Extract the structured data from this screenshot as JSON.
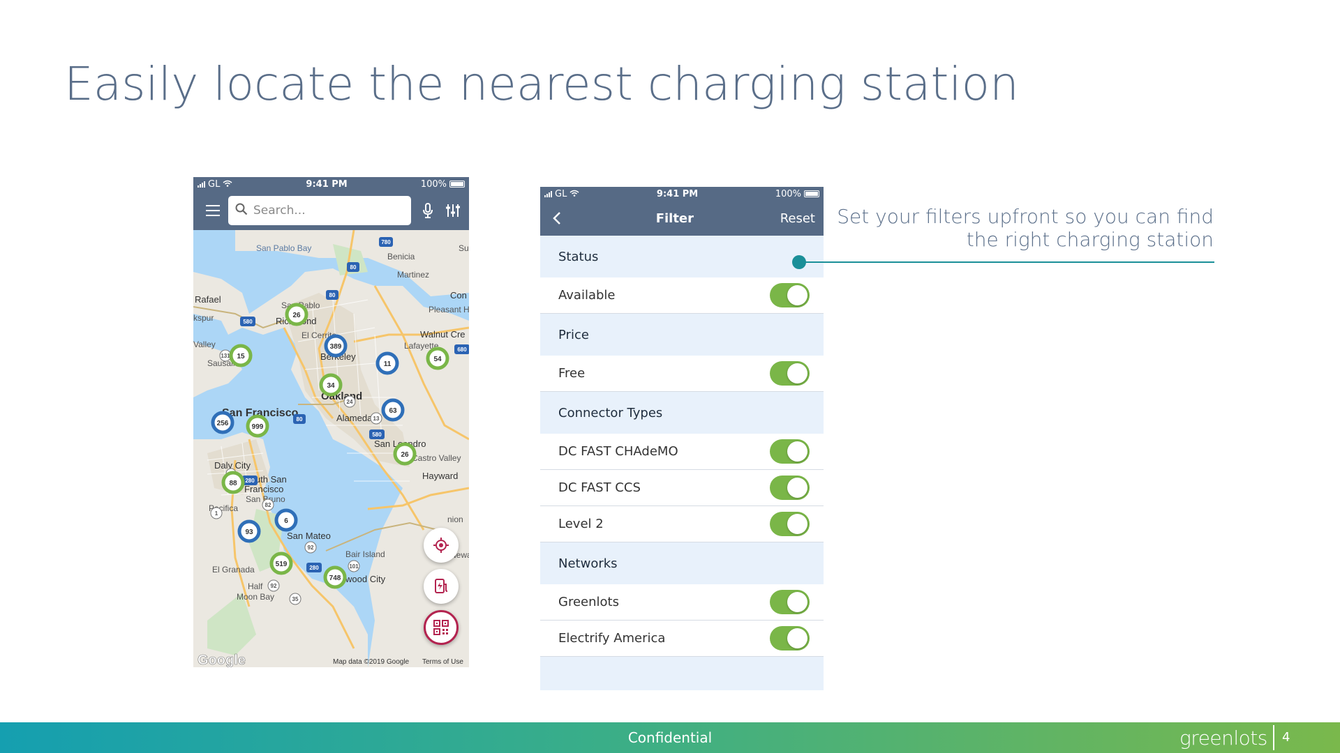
{
  "slide": {
    "title": "Easily locate the nearest charging station",
    "callout": "Set your filters upfront so you can find the right charging station",
    "footer": "Confidential",
    "logo": "greenlots",
    "page_number": "4"
  },
  "map_phone": {
    "status": {
      "carrier": "GL",
      "time": "9:41 PM",
      "battery": "100%"
    },
    "search_placeholder": "Search...",
    "map_labels": [
      "San Pablo Bay",
      "Benicia",
      "Martinez",
      "Rafael",
      "San Pablo",
      "Richmond",
      "El Cerrito",
      "Berkeley",
      "Lafayette",
      "Walnut Cre",
      "Pleasant H",
      "Con",
      "Sausalito",
      "Oakland",
      "Alameda",
      "San Francisco",
      "San Leandro",
      "Castro Valley",
      "Hayward",
      "Daly City",
      "South San",
      "Francisco",
      "San Bruno",
      "Pacifica",
      "San Mateo",
      "Bair Island",
      "El Granada",
      "wood City",
      "Half",
      "Moon Bay",
      "kspur",
      "Valley",
      "Sul",
      "nion",
      "Newa"
    ],
    "station_counts": [
      "26",
      "389",
      "15",
      "11",
      "54",
      "34",
      "63",
      "256",
      "999",
      "26",
      "88",
      "6",
      "93",
      "519",
      "748"
    ],
    "attribution": {
      "google": "Google",
      "map_data": "Map data ©2019 Google",
      "terms": "Terms of Use"
    },
    "highway_shields": [
      "780",
      "80",
      "80",
      "580",
      "131",
      "24",
      "13",
      "580",
      "80",
      "280",
      "82",
      "1",
      "92",
      "280",
      "101",
      "35",
      "92",
      "680",
      "1"
    ]
  },
  "filter_phone": {
    "status": {
      "carrier": "GL",
      "time": "9:41 PM",
      "battery": "100%"
    },
    "title": "Filter",
    "reset": "Reset",
    "sections": [
      {
        "label": "Status",
        "options": [
          {
            "label": "Available",
            "on": true
          }
        ]
      },
      {
        "label": "Price",
        "options": [
          {
            "label": "Free",
            "on": true
          }
        ]
      },
      {
        "label": "Connector Types",
        "options": [
          {
            "label": "DC FAST CHAdeMO",
            "on": true
          },
          {
            "label": "DC FAST CCS",
            "on": true
          },
          {
            "label": "Level 2",
            "on": true
          }
        ]
      },
      {
        "label": "Networks",
        "options": [
          {
            "label": "Greenlots",
            "on": true
          },
          {
            "label": "Electrify America",
            "on": true
          }
        ]
      }
    ]
  },
  "colors": {
    "header": "#566a85",
    "accent_teal": "#1a8f98",
    "toggle_on": "#7ab648",
    "section_bg": "#e8f1fb",
    "title_text": "#5a6e89",
    "fab_red": "#b3234f"
  },
  "icons": [
    "hamburger-icon",
    "search-icon",
    "microphone-icon",
    "filter-sliders-icon",
    "back-chevron-icon",
    "locate-target-icon",
    "charging-station-icon",
    "qr-code-icon"
  ]
}
